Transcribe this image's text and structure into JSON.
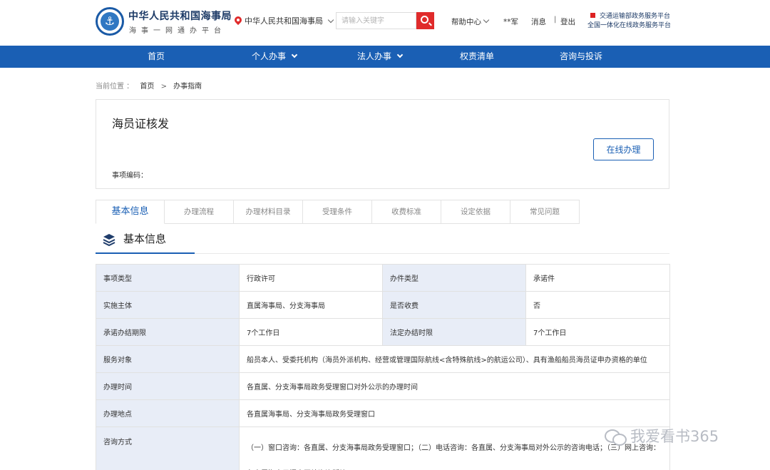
{
  "header": {
    "brand_title": "中华人民共和国海事局",
    "brand_sub": "海事一网通办平台",
    "location": "中华人民共和国海事局",
    "search_placeholder": "请输入关键字",
    "help": "帮助中心",
    "user": "**军",
    "messages": "消息",
    "separator": "|",
    "logout": "登出",
    "platform_line1": "交通运输部政务服务平台",
    "platform_line2": "全国一体化在线政务服务平台"
  },
  "nav": {
    "items": [
      {
        "label": "首页"
      },
      {
        "label": "个人办事"
      },
      {
        "label": "法人办事"
      },
      {
        "label": "权责清单"
      },
      {
        "label": "咨询与投诉"
      }
    ]
  },
  "breadcrumb": {
    "prefix": "当前位置 ：",
    "home": "首页",
    "arrow": ">",
    "current": "办事指南"
  },
  "card": {
    "title": "海员证核发",
    "code_label": "事项编码：",
    "online_button": "在线办理"
  },
  "tabs": [
    {
      "label": "基本信息"
    },
    {
      "label": "办理流程"
    },
    {
      "label": "办理材料目录"
    },
    {
      "label": "受理条件"
    },
    {
      "label": "收费标准"
    },
    {
      "label": "设定依据"
    },
    {
      "label": "常见问题"
    }
  ],
  "section": {
    "title": "基本信息",
    "icon": "layers-icon"
  },
  "info": {
    "r1": {
      "k1": "事项类型",
      "v1": "行政许可",
      "k2": "办件类型",
      "v2": "承诺件"
    },
    "r2": {
      "k1": "实施主体",
      "v1": "直属海事局、分支海事局",
      "k2": "是否收费",
      "v2": "否"
    },
    "r3": {
      "k1": "承诺办结期限",
      "v1": "7个工作日",
      "k2": "法定办结时限",
      "v2": "7个工作日"
    },
    "service_target": {
      "k": "服务对象",
      "v": "船员本人、受委托机构（海员外派机构、经营或管理国际航线<含特殊航线>的航运公司）、具有渔船船员海员证申办资格的单位"
    },
    "hours": {
      "k": "办理时间",
      "v": "各直属、分支海事局政务受理窗口对外公示的办理时间"
    },
    "place": {
      "k": "办理地点",
      "v": "各直属海事局、分支海事局政务受理窗口"
    },
    "consult": {
      "k": "咨询方式",
      "v": "（一）窗口咨询：各直属、分支海事局政务受理窗口；（二）电话咨询：各直属、分支海事局对外公示的咨询电话；（三）网上咨询：各直属海事局门户网站咨询版块。"
    }
  },
  "watermark": "我爱看书365",
  "colors": {
    "primary": "#1a5fb4",
    "accent_red": "#e02b2b",
    "label_bg": "#e8edf7"
  }
}
